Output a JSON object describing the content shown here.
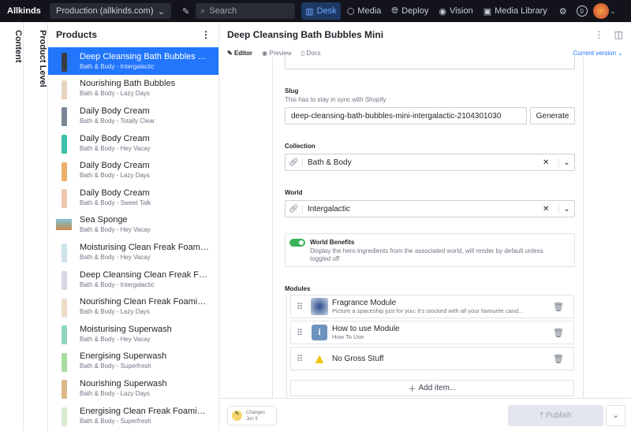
{
  "topbar": {
    "brand": "Allkinds",
    "dataset": "Production (allkinds.com)",
    "search_placeholder": "Search",
    "nav": [
      {
        "label": "Desk",
        "icon": "desk-icon",
        "active": true
      },
      {
        "label": "Media",
        "icon": "cube-icon"
      },
      {
        "label": "Deploy",
        "icon": "globe-icon"
      },
      {
        "label": "Vision",
        "icon": "eye-icon"
      },
      {
        "label": "Media Library",
        "icon": "image-icon"
      }
    ],
    "notification_count": "0"
  },
  "side_tabs": [
    "Content",
    "Product Level"
  ],
  "products": {
    "title": "Products",
    "items": [
      {
        "title": "Deep Cleansing Bath Bubbles Mini",
        "subtitle": "Bath & Body - Intergalactic",
        "color": "#3a3d44",
        "selected": true
      },
      {
        "title": "Nourishing Bath Bubbles",
        "subtitle": "Bath & Body - Lazy Days",
        "color": "#e6d4c3"
      },
      {
        "title": "Daily Body Cream",
        "subtitle": "Bath & Body - Totally Clear",
        "color": "#7c8596"
      },
      {
        "title": "Daily Body Cream",
        "subtitle": "Bath & Body - Hey Vacay",
        "color": "#3bbfa8"
      },
      {
        "title": "Daily Body Cream",
        "subtitle": "Bath & Body - Lazy Days",
        "color": "#eab06a"
      },
      {
        "title": "Daily Body Cream",
        "subtitle": "Bath & Body - Sweet Talk",
        "color": "#efc7b0"
      },
      {
        "title": "Sea Sponge",
        "subtitle": "Bath & Body - Hey Vacay",
        "color": "#c98a4c"
      },
      {
        "title": "Moisturising Clean Freak Foaming ...",
        "subtitle": "Bath & Body - Hey Vacay",
        "color": "#cfe3ea"
      },
      {
        "title": "Deep Cleansing Clean Freak Foam...",
        "subtitle": "Bath & Body - Intergalactic",
        "color": "#d5dae0"
      },
      {
        "title": "Nourishing Clean Freak Foaming ...",
        "subtitle": "Bath & Body - Lazy Days",
        "color": "#ecdcc8"
      },
      {
        "title": "Moisturising Superwash",
        "subtitle": "Bath & Body - Hey Vacay",
        "color": "#8fd6c4"
      },
      {
        "title": "Energising Superwash",
        "subtitle": "Bath & Body - Superfresh",
        "color": "#a9dca0"
      },
      {
        "title": "Nourishing Superwash",
        "subtitle": "Bath & Body - Lazy Days",
        "color": "#dcb98a"
      },
      {
        "title": "Energising Clean Freak Foaming H...",
        "subtitle": "Bath & Body - Superfresh",
        "color": "#d6ecd0"
      }
    ]
  },
  "editor": {
    "title": "Deep Cleansing Bath Bubbles Mini",
    "tabs": [
      "Editor",
      "Preview",
      "Docs"
    ],
    "version": "Current version",
    "slug": {
      "label": "Slug",
      "description": "This has to stay in sync with Shopify",
      "value": "deep-cleansing-bath-bubbles-mini-intergalactic-2104301030",
      "button": "Generate"
    },
    "collection": {
      "label": "Collection",
      "value": "Bath & Body"
    },
    "world": {
      "label": "World",
      "value": "Intergalactic"
    },
    "world_benefits": {
      "label": "World Benefits",
      "description": "Display the hero ingredients from the associated world, will render by default unless toggled off",
      "enabled": true
    },
    "modules": {
      "label": "Modules",
      "items": [
        {
          "title": "Fragrance Module",
          "subtitle": "Picture a spaceship just for you: it's stocked with all your favourite cand..."
        },
        {
          "title": "How to use Module",
          "subtitle": "How To Use"
        },
        {
          "title": "No Gross Stuff",
          "subtitle": ""
        }
      ],
      "add_label": "Add item..."
    },
    "footer": {
      "changes_label": "Changes",
      "changes_date": "Jun 9",
      "publish": "Publish"
    }
  },
  "colors": {
    "accent": "#2276fc",
    "topbar": "#13141b",
    "toggle": "#3ab45a"
  }
}
